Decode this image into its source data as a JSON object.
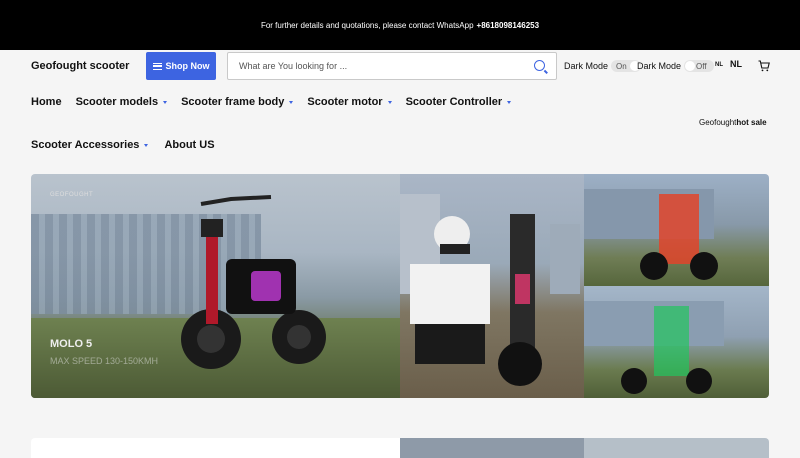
{
  "announcement": {
    "text": "For further details and quotations, please contact WhatsApp",
    "phone": "+8618098146253"
  },
  "header": {
    "brand": "Geofought scooter",
    "shop_now": "Shop Now",
    "search_placeholder": "What are You looking for ...",
    "dark_mode_1": {
      "label": "Dark Mode",
      "state": "On"
    },
    "dark_mode_2": {
      "label": "Dark Mode",
      "state": "Off"
    },
    "lang_small": "NL",
    "lang": "NL"
  },
  "nav": {
    "items": [
      {
        "label": "Home",
        "dropdown": false
      },
      {
        "label": "Scooter models",
        "dropdown": true
      },
      {
        "label": "Scooter frame body",
        "dropdown": true
      },
      {
        "label": "Scooter motor",
        "dropdown": true
      },
      {
        "label": "Scooter Controller",
        "dropdown": true
      },
      {
        "label": "Scooter Accessories",
        "dropdown": true
      },
      {
        "label": "About US",
        "dropdown": false
      }
    ],
    "hotsale_prefix": "Geofought",
    "hotsale_bold": "hot sale"
  },
  "hero": {
    "tag": "GEOFOUGHT",
    "title": "MOLO 5",
    "subtitle": "MAX SPEED 130-150KMH"
  },
  "colors": {
    "accent": "#3d64e1",
    "topbar": "#000000"
  }
}
